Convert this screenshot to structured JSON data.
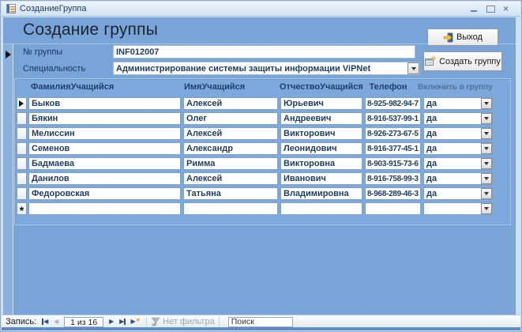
{
  "window": {
    "tab_title": "СозданиеГруппа"
  },
  "form": {
    "title": "Создание группы",
    "fields": {
      "group_number": {
        "label": "№ группы",
        "value": "INF012007"
      },
      "specialty": {
        "label": "Специальность",
        "value": "Администрирование системы защиты информации ViPNet"
      }
    },
    "buttons": {
      "exit": "Выход",
      "create_group": "Создать группу"
    }
  },
  "table": {
    "headers": {
      "lastname": "ФамилияУчащийся",
      "firstname": "ИмяУчащийся",
      "patronymic": "ОтчествоУчащийся",
      "phone": "Телефон",
      "include": "Включить в группу"
    },
    "rows": [
      {
        "lastname": "Быков",
        "firstname": "Алексей",
        "patronymic": "Юрьевич",
        "phone": "8-925-982-94-7",
        "include": "да"
      },
      {
        "lastname": "Бякин",
        "firstname": "Олег",
        "patronymic": "Андреевич",
        "phone": "8-916-537-99-1",
        "include": "да"
      },
      {
        "lastname": "Мелиссин",
        "firstname": "Алексей",
        "patronymic": "Викторович",
        "phone": "8-926-273-67-5",
        "include": "да"
      },
      {
        "lastname": "Семенов",
        "firstname": "Александр",
        "patronymic": "Леонидович",
        "phone": "8-916-377-45-1",
        "include": "да"
      },
      {
        "lastname": "Бадмаева",
        "firstname": "Римма",
        "patronymic": "Викторовна",
        "phone": "8-903-915-73-6",
        "include": "да"
      },
      {
        "lastname": "Данилов",
        "firstname": "Алексей",
        "patronymic": "Иванович",
        "phone": "8-916-758-99-3",
        "include": "да"
      },
      {
        "lastname": "Федоровская",
        "firstname": "Татьяна",
        "patronymic": "Владимировна",
        "phone": "8-968-289-46-3",
        "include": "да"
      }
    ],
    "new_row_marker": "*"
  },
  "navbar": {
    "record_label": "Запись:",
    "record_counter": "1 из 16",
    "no_filter_label": "Нет фильтра",
    "search_placeholder": "Поиск"
  }
}
